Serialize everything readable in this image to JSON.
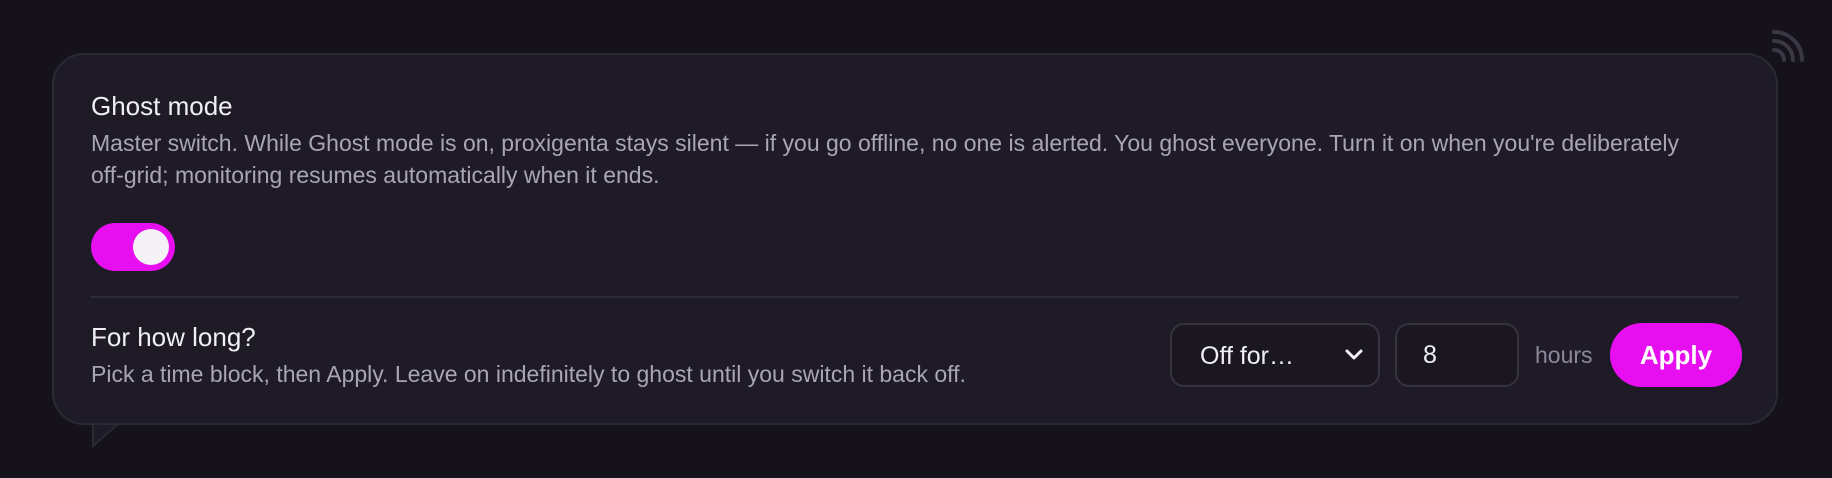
{
  "ghost_mode": {
    "title": "Ghost mode",
    "description": "Master switch. While Ghost mode is on, proxigenta stays silent — if you go offline, no one is alerted. You ghost everyone. Turn it on when you're deliberately off-grid; monitoring resumes automatically when it ends.",
    "toggle_on": true
  },
  "duration": {
    "title": "For how long?",
    "description": "Pick a time block, then Apply. Leave on indefinitely to ghost until you switch it back off.",
    "select_value": "Off for…",
    "hours_value": "8",
    "unit_label": "hours",
    "apply_label": "Apply"
  },
  "icons": {
    "corner": "signal-icon",
    "select_arrow": "chevron-down-icon"
  },
  "colors": {
    "accent": "#e70ff0",
    "background": "#15121b",
    "card": "#1e1b26",
    "text_primary": "#f1eef6",
    "text_secondary": "#aaa5b6"
  }
}
